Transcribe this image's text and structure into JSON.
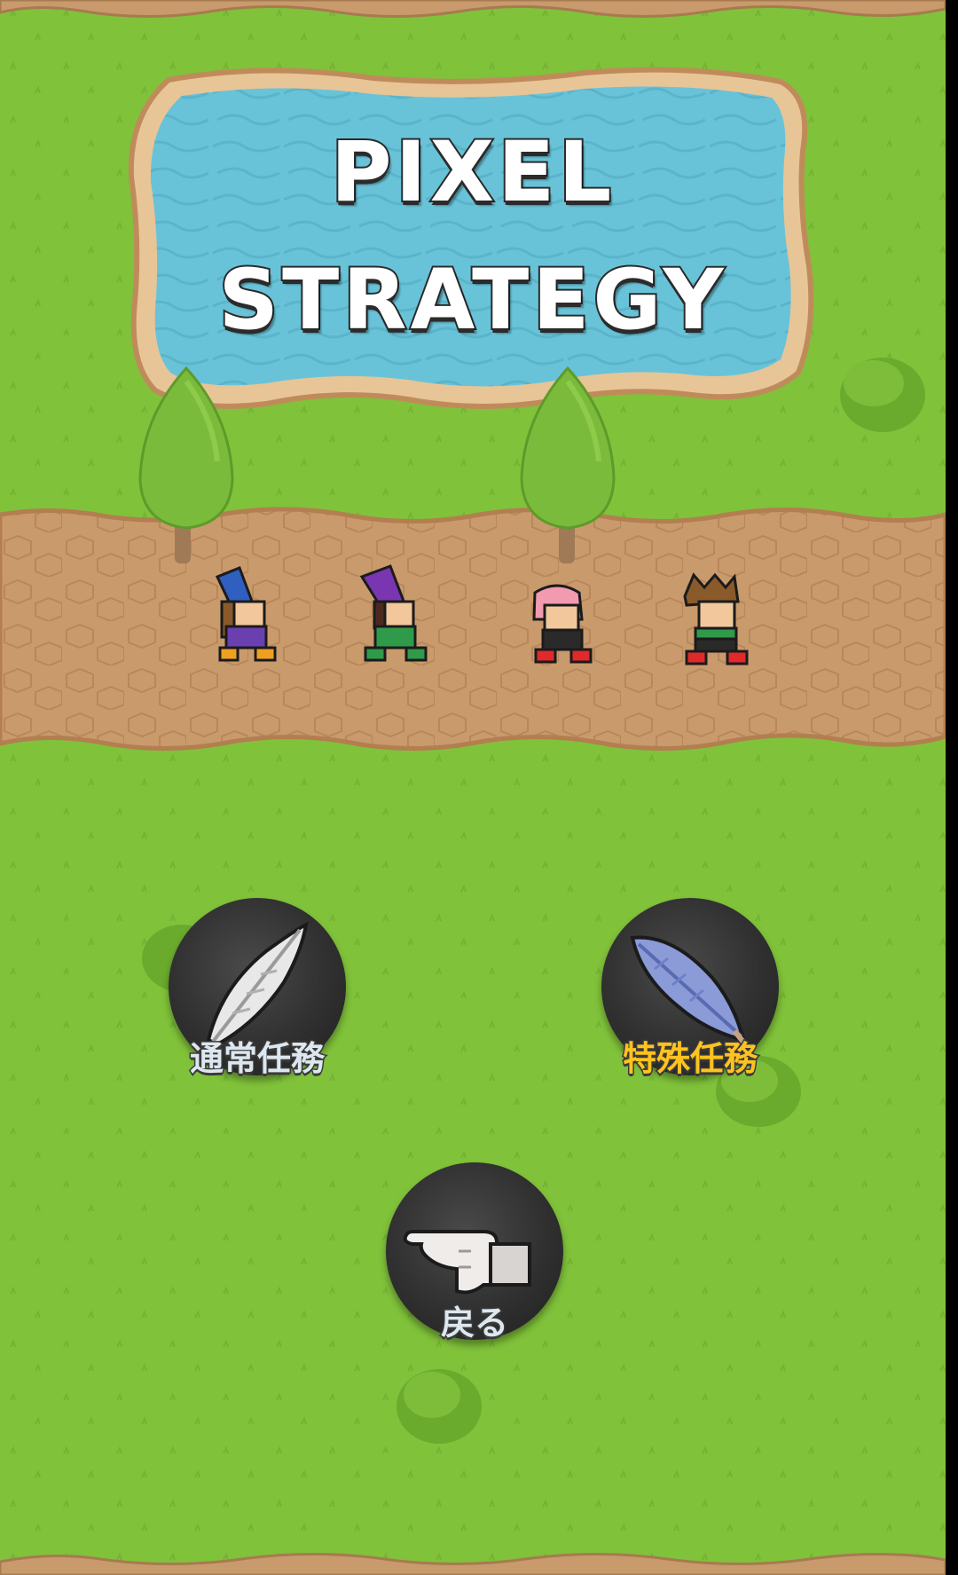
{
  "game": {
    "title_line1": "PIXEL",
    "title_line2": "STRATEGY"
  },
  "menu": {
    "normal_mission_label": "通常任務",
    "special_mission_label": "特殊任務",
    "back_label": "戻る"
  },
  "icons": {
    "normal_mission": "white-feather-icon",
    "special_mission": "blue-feather-icon",
    "back": "pointing-hand-icon"
  },
  "colors": {
    "grass": "#80c23a",
    "dirt_path": "#c99a6c",
    "water": "#69c3d8",
    "button": "#333333",
    "special_label": "#ffc21f",
    "normal_label": "#dde7ef"
  }
}
